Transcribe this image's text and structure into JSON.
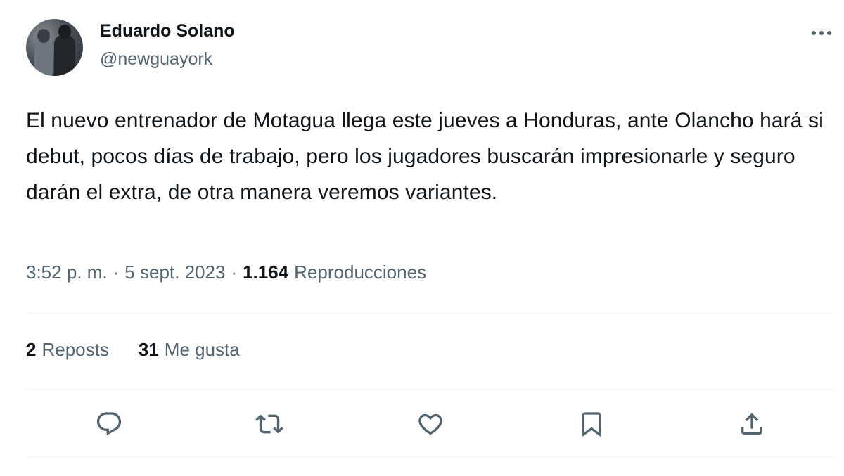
{
  "user": {
    "name": "Eduardo Solano",
    "handle": "@newguayork",
    "avatar_icon": "user-avatar-photo"
  },
  "tweet": {
    "text": "El nuevo entrenador de Motagua llega este jueves a Honduras, ante Olancho hará si debut, pocos días de trabajo, pero los jugadores buscarán impresionarle y seguro darán el extra, de otra manera veremos variantes."
  },
  "meta": {
    "time": "3:52 p. m.",
    "separator": "·",
    "date": "5 sept. 2023",
    "views_count": "1.164",
    "views_label": "Reproducciones"
  },
  "stats": {
    "reposts_count": "2",
    "reposts_label": "Reposts",
    "likes_count": "31",
    "likes_label": "Me gusta"
  },
  "actions": {
    "reply_icon": "reply-icon",
    "repost_icon": "repost-icon",
    "like_icon": "heart-icon",
    "bookmark_icon": "bookmark-icon",
    "share_icon": "share-icon",
    "more_icon": "more-options-icon"
  },
  "colors": {
    "text_primary": "#0f1419",
    "text_secondary": "#536471",
    "divider": "#eff3f4"
  }
}
